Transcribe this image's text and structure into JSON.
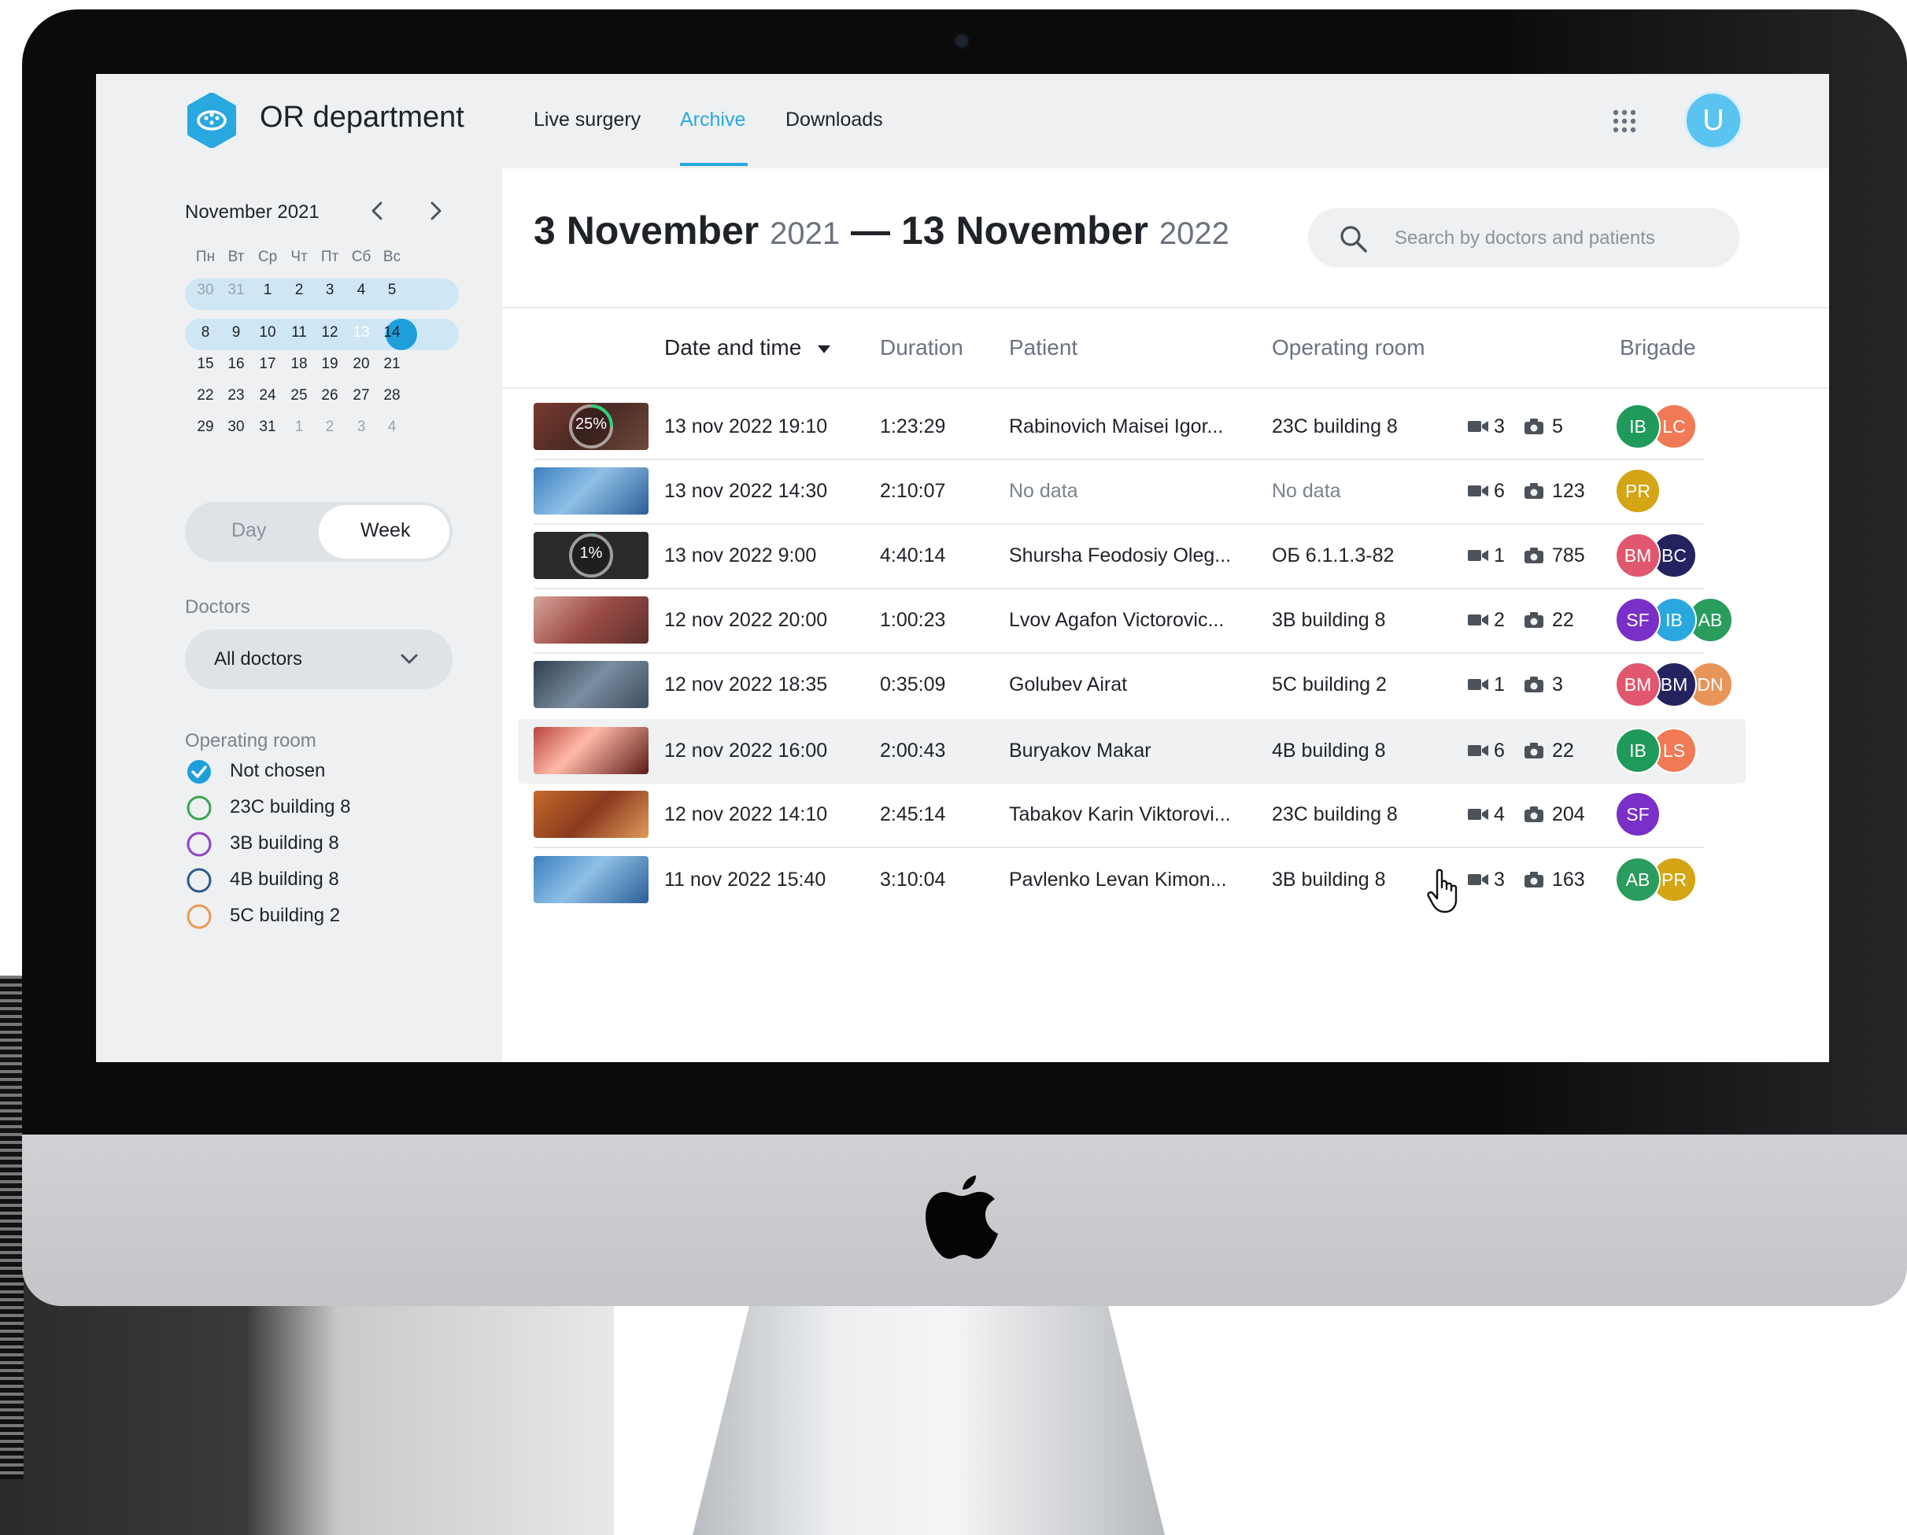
{
  "app": {
    "title": "OR department"
  },
  "nav": [
    {
      "label": "Live surgery",
      "active": false
    },
    {
      "label": "Archive",
      "active": true
    },
    {
      "label": "Downloads",
      "active": false
    }
  ],
  "user": {
    "initial": "U"
  },
  "calendar": {
    "month": "November 2021",
    "weekdays": [
      "Пн",
      "Вт",
      "Ср",
      "Чт",
      "Пт",
      "Сб",
      "Вс"
    ],
    "weeks": [
      [
        "30",
        "31",
        "1",
        "2",
        "3",
        "4",
        "5"
      ],
      [
        "8",
        "9",
        "10",
        "11",
        "12",
        "13",
        "14"
      ],
      [
        "15",
        "16",
        "17",
        "18",
        "19",
        "20",
        "21"
      ],
      [
        "22",
        "23",
        "24",
        "25",
        "26",
        "27",
        "28"
      ],
      [
        "29",
        "30",
        "31",
        "1",
        "2",
        "3",
        "4"
      ]
    ],
    "selected_day": "13"
  },
  "view_toggle": {
    "day": "Day",
    "week": "Week",
    "selected": "Week"
  },
  "filters": {
    "doctors_label": "Doctors",
    "doctors_value": "All doctors",
    "room_label": "Operating room",
    "rooms": [
      {
        "label": "Not chosen",
        "checked": true,
        "color": "#1e9fdc"
      },
      {
        "label": "23C building 8",
        "checked": false,
        "color": "#3aa655"
      },
      {
        "label": "3B building 8",
        "checked": false,
        "color": "#8e44c7"
      },
      {
        "label": "4B building 8",
        "checked": false,
        "color": "#2d5a8c"
      },
      {
        "label": "5C building 2",
        "checked": false,
        "color": "#e89a55"
      }
    ]
  },
  "range": {
    "start": "3 November",
    "start_year": "2021",
    "dash": "—",
    "end": "13 November",
    "end_year": "2022"
  },
  "search": {
    "placeholder": "Search by doctors and patients"
  },
  "table": {
    "columns": [
      "Date and time",
      "Duration",
      "Patient",
      "Operating room",
      "Brigade"
    ],
    "rows": [
      {
        "date": "13 nov 2022 19:10",
        "duration": "1:23:29",
        "patient": "Rabinovich Maisei Igor...",
        "room": "23C building 8",
        "videos": "3",
        "photos": "5",
        "progress": "25%",
        "progress_value": 0.25,
        "thumb": "processing",
        "brigade": [
          {
            "i": "IB",
            "c": "#1f9a5a"
          },
          {
            "i": "LC",
            "c": "#f07a55"
          }
        ]
      },
      {
        "date": "13 nov 2022 14:30",
        "duration": "2:10:07",
        "patient": "No data",
        "room": "No data",
        "videos": "6",
        "photos": "123",
        "thumb": "blue",
        "brigade": [
          {
            "i": "PR",
            "c": "#d4a514"
          }
        ]
      },
      {
        "date": "13 nov 2022 9:00",
        "duration": "4:40:14",
        "patient": "Shursha Feodosiy Oleg...",
        "room": "ОБ 6.1.1.3-82",
        "videos": "1",
        "photos": "785",
        "progress": "1%",
        "progress_value": 0.01,
        "thumb": "dark",
        "brigade": [
          {
            "i": "BM",
            "c": "#e0576f"
          },
          {
            "i": "BC",
            "c": "#23245f"
          }
        ]
      },
      {
        "date": "12 nov 2022 20:00",
        "duration": "1:00:23",
        "patient": "Lvov Agafon Victorovic...",
        "room": "3B building 8",
        "videos": "2",
        "photos": "22",
        "thumb": "warm",
        "brigade": [
          {
            "i": "SF",
            "c": "#7a2fc9"
          },
          {
            "i": "IB",
            "c": "#29a8e0"
          },
          {
            "i": "AB",
            "c": "#2a9c5e"
          }
        ]
      },
      {
        "date": "12 nov 2022 18:35",
        "duration": "0:35:09",
        "patient": "Golubev Airat",
        "room": "5C building 2",
        "videos": "1",
        "photos": "3",
        "thumb": "room",
        "brigade": [
          {
            "i": "BM",
            "c": "#e0576f"
          },
          {
            "i": "BM",
            "c": "#23245f"
          },
          {
            "i": "DN",
            "c": "#e8955a"
          }
        ]
      },
      {
        "date": "12 nov 2022 16:00",
        "duration": "2:00:43",
        "patient": "Buryakov Makar",
        "room": "4B building 8",
        "videos": "6",
        "photos": "22",
        "thumb": "red",
        "hover": true,
        "brigade": [
          {
            "i": "IB",
            "c": "#1f9a5a"
          },
          {
            "i": "LS",
            "c": "#f07a55"
          }
        ]
      },
      {
        "date": "12 nov 2022 14:10",
        "duration": "2:45:14",
        "patient": "Tabakov Karin Viktorovi...",
        "room": "23C building 8",
        "videos": "4",
        "photos": "204",
        "thumb": "orange",
        "brigade": [
          {
            "i": "SF",
            "c": "#7a2fc9"
          }
        ]
      },
      {
        "date": "11 nov 2022 15:40",
        "duration": "3:10:04",
        "patient": "Pavlenko Levan Kimon...",
        "room": "3B building 8",
        "videos": "3",
        "photos": "163",
        "thumb": "blue",
        "brigade": [
          {
            "i": "AB",
            "c": "#2a9c5e"
          },
          {
            "i": "PR",
            "c": "#d4a514"
          }
        ]
      }
    ]
  },
  "colors": {
    "accent": "#29a8e0",
    "sidebar_bg": "#eef0f2",
    "text": "#1f2328",
    "muted": "#6b7280"
  }
}
